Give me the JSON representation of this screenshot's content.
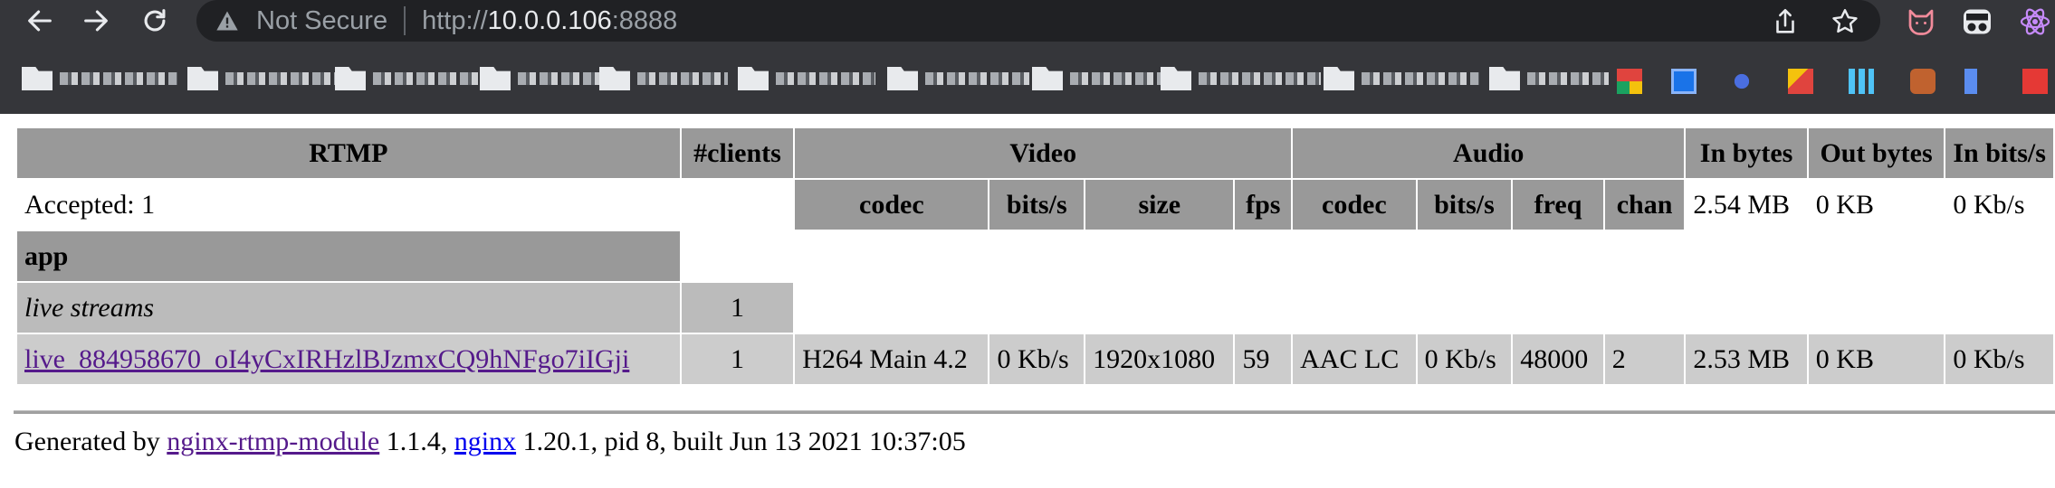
{
  "browser": {
    "security_label": "Not Secure",
    "url_scheme": "http://",
    "url_host": "10.0.0.106",
    "url_port": ":8888"
  },
  "table": {
    "headers": {
      "rtmp": "RTMP",
      "clients": "#clients",
      "video": "Video",
      "audio": "Audio",
      "in_bytes": "In bytes",
      "out_bytes": "Out bytes",
      "in_bits": "In bits/s"
    },
    "subheaders": {
      "video_codec": "codec",
      "video_bits": "bits/s",
      "video_size": "size",
      "video_fps": "fps",
      "audio_codec": "codec",
      "audio_bits": "bits/s",
      "audio_freq": "freq",
      "audio_chan": "chan"
    },
    "server": {
      "accepted": "Accepted: 1",
      "in_bytes": "2.54 MB",
      "out_bytes": "0 KB",
      "in_bits": "0 Kb/s"
    },
    "app": {
      "name": "app",
      "live_label": "live streams",
      "live_count": "1"
    },
    "stream": {
      "name": "live_884958670_oI4yCxIRHzlBJzmxCQ9hNFgo7iIGji",
      "clients": "1",
      "video_codec": "H264 Main 4.2",
      "video_bits": "0 Kb/s",
      "video_size": "1920x1080",
      "video_fps": "59",
      "audio_codec": "AAC LC",
      "audio_bits": "0 Kb/s",
      "audio_freq": "48000",
      "audio_chan": "2",
      "in_bytes": "2.53 MB",
      "out_bytes": "0 KB",
      "in_bits": "0 Kb/s"
    }
  },
  "footer": {
    "prefix": "Generated by ",
    "module_link": "nginx-rtmp-module",
    "module_version": " 1.1.4, ",
    "nginx_link": "nginx",
    "rest": " 1.20.1, pid 8, built Jun 13 2021 10:37:05"
  }
}
